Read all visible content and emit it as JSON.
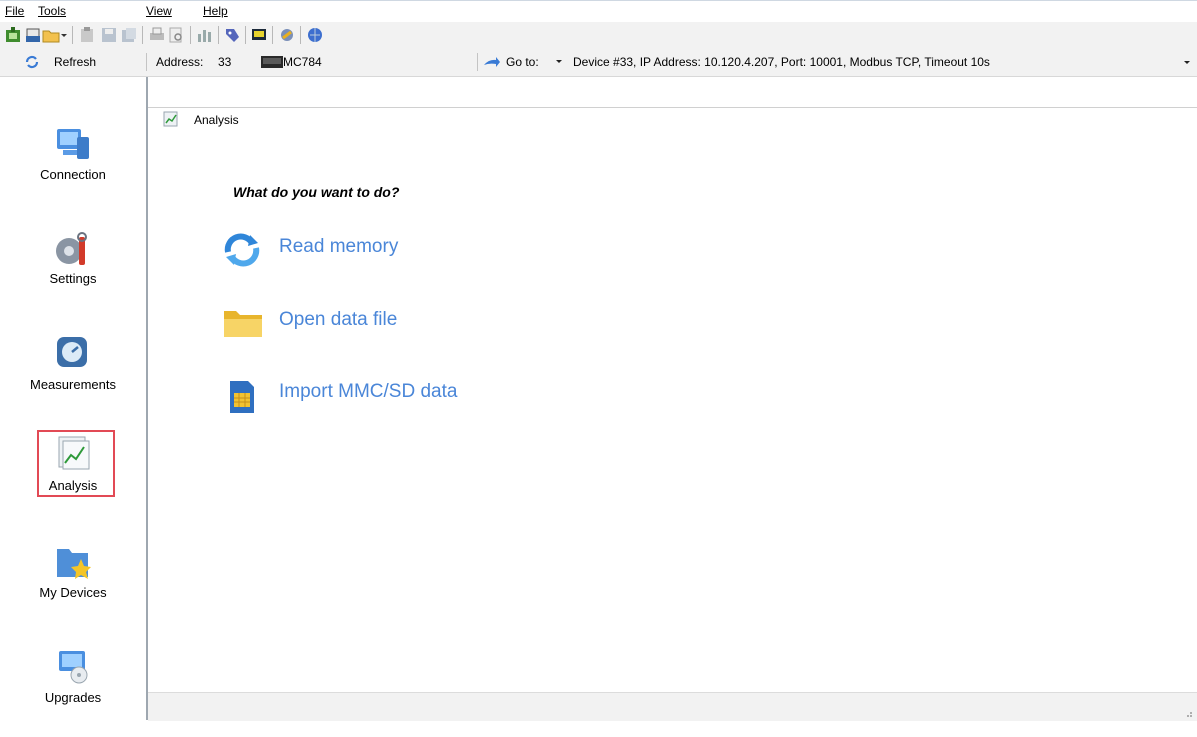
{
  "menu": [
    {
      "label": "File"
    },
    {
      "label": "Tools"
    },
    {
      "label": "View"
    },
    {
      "label": "Help"
    }
  ],
  "addressbar": {
    "refresh_label": "Refresh",
    "address_label": "Address:",
    "address_value": "33",
    "device_model": "MC784",
    "goto_label": "Go to:",
    "connection_info": "Device #33, IP Address: 10.120.4.207, Port: 10001, Modbus TCP, Timeout 10s"
  },
  "sidebar": {
    "items": [
      {
        "label": "Connection",
        "icon": "connection-icon"
      },
      {
        "label": "Settings",
        "icon": "settings-icon"
      },
      {
        "label": "Measurements",
        "icon": "measurements-icon"
      },
      {
        "label": "Analysis",
        "icon": "analysis-icon",
        "selected": true
      },
      {
        "label": "My Devices",
        "icon": "my-devices-icon"
      },
      {
        "label": "Upgrades",
        "icon": "upgrades-icon"
      }
    ],
    "selected_border_color": "#e24a55"
  },
  "breadcrumb": {
    "title": "Analysis"
  },
  "main": {
    "question": "What do you want to do?",
    "actions": [
      {
        "label": "Read memory",
        "icon": "refresh-arrows-icon"
      },
      {
        "label": "Open data file",
        "icon": "folder-icon"
      },
      {
        "label": "Import MMC/SD data",
        "icon": "sd-card-icon"
      }
    ],
    "link_color": "#4a86d8"
  }
}
